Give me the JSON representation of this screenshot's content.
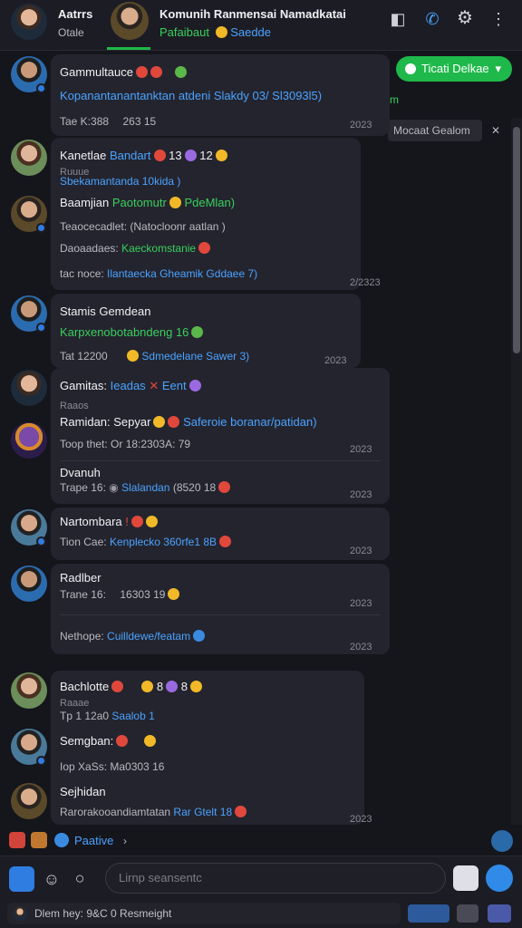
{
  "header": {
    "user_name": "Aatrrs",
    "user_status": "Otale",
    "channel_title": "Komunih Ranmensai Namadkatai",
    "channel_sub_green": "Pafaibaut",
    "channel_sub_blue": "Saedde",
    "icons": [
      "mute-icon",
      "call-icon",
      "settings-icon",
      "more-icon"
    ]
  },
  "side": {
    "green_button_label": "Ticati Delkae",
    "green_mark": "m",
    "chip_label": "Mocaat Gealom",
    "chip_close": "✕"
  },
  "messages": [
    {
      "name": "Gammultauce",
      "text": "Kopanantanantanktan atdeni Slakdy 03/ Sl3093l5)",
      "meta": "Tae K:388 ⠀ 263 15",
      "time": "2023"
    },
    {
      "name": "Kanetlae",
      "name_link": "Bandart",
      "count": "13",
      "count2": "12",
      "sub1": "Ruuue",
      "sub2": "Sbekamantanda 10kida )",
      "time": ""
    },
    {
      "name": "Baamjian",
      "name_link_green": "Paotomutr",
      "name_link_blue": "PdeMlan)",
      "line2": "Teaocecadlet: (Natocloonr aatlan )",
      "line3_label": "Daoaadaes:",
      "line3_value": "Kaeckomstanie",
      "line4_label": "tac noce:",
      "line4_value": "Ilantaecka Gheamik Gddaee 7)",
      "time": "2/2323"
    },
    {
      "name": "Stamis Gemdean",
      "text": "Karpxenobotabndeng 16",
      "meta_label": "Tat 12200",
      "meta_value": "Sdmedelane Sawer 3)",
      "time": "2023"
    },
    {
      "name": "Gamitas:",
      "name_link": "Ieadas",
      "name_link2": "Eent",
      "sub": "Raaos"
    },
    {
      "name": "Ramidan:",
      "name_plain": "Sepyar",
      "name_link": "Saferoie boranar/patidan)",
      "meta": "Toop thet: Or 18:2303A: 79",
      "time": "2023"
    },
    {
      "name": "Dvanuh",
      "meta_label": "Trape 16:",
      "meta_value_a": "Slalandan",
      "meta_value_b": "(8520 18",
      "time": "2023"
    },
    {
      "name": "Nartombara",
      "meta_label": "Tion Cae:",
      "meta_value": "Kenplecko 360rfe1 8B",
      "time": "2023"
    },
    {
      "name": "Radlber",
      "meta": "Trane 16: ⠀ 16303 19",
      "time": "2023"
    },
    {
      "name": "Nethope:",
      "name_link": "Cuilldewe/featam",
      "time": "2023"
    },
    {
      "name": "Bachlotte",
      "sub1": "Raaae",
      "sub2": "Tp 1 12a0",
      "sub2_link": "Saalob 1",
      "emoji_counts": [
        "8",
        "8"
      ]
    },
    {
      "name": "Semgban:",
      "meta": "Iop XaSs: Ma0303 16"
    },
    {
      "name": "Sejhidan",
      "text": "Rarorakooandiamtatan",
      "link": "Rar Gtelt 18",
      "time": "2023"
    }
  ],
  "reaction_bar": {
    "label": "Paative"
  },
  "composer": {
    "placeholder": "Lirnp seansentc",
    "status_text": "Dlem hey: 9&C 0 Resmeight",
    "icons": [
      "apps-icon",
      "people-icon",
      "circle-icon",
      "camera-icon",
      "send-icon",
      "translate-icon",
      "screen-icon",
      "mention-icon"
    ]
  },
  "colors": {
    "accent": "#4aa3ff",
    "green": "#1fb84a",
    "bg": "#15151c"
  }
}
